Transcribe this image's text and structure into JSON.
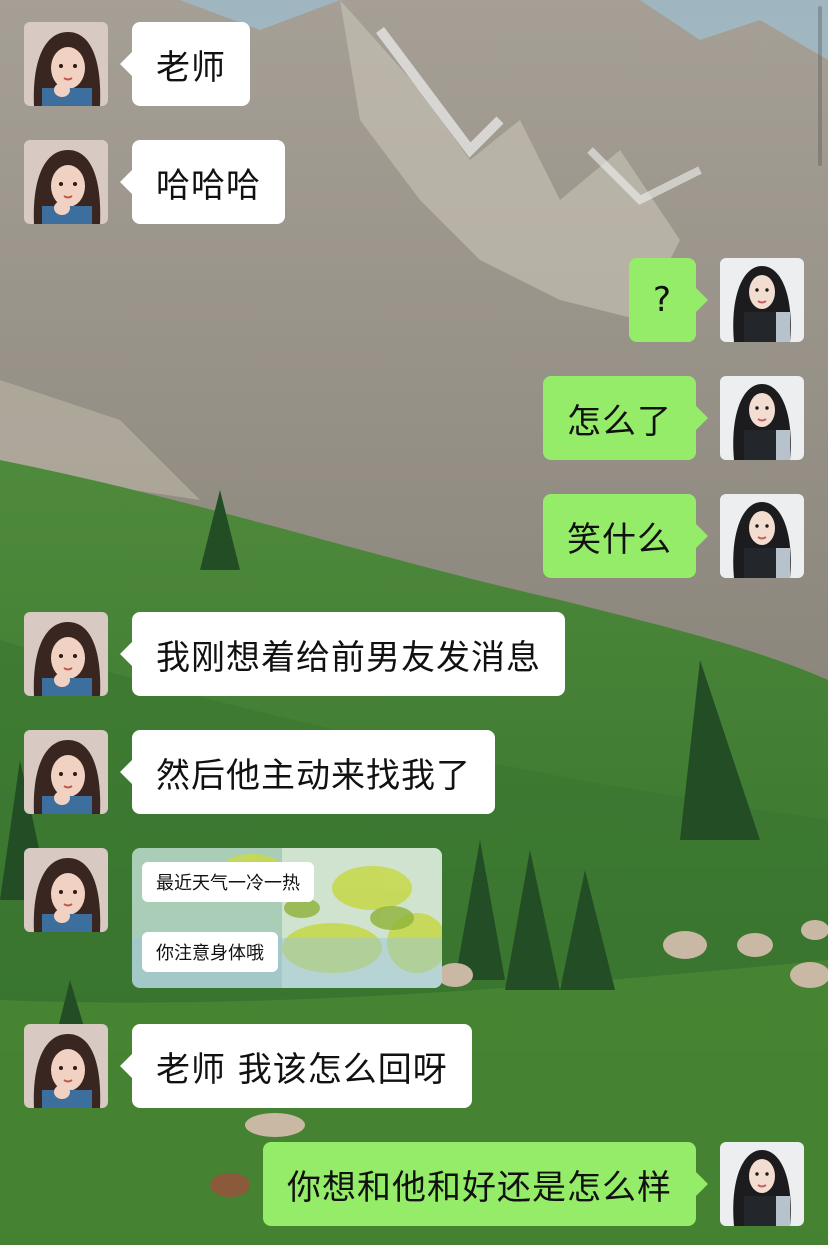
{
  "colors": {
    "incoming_bubble": "#ffffff",
    "outgoing_bubble": "#95ec69",
    "text": "#111111"
  },
  "messages": [
    {
      "side": "in",
      "text": "老师"
    },
    {
      "side": "in",
      "text": "哈哈哈"
    },
    {
      "side": "out",
      "text": "?"
    },
    {
      "side": "out",
      "text": "怎么了"
    },
    {
      "side": "out",
      "text": "笑什么"
    },
    {
      "side": "in",
      "text": "我刚想着给前男友发消息"
    },
    {
      "side": "in",
      "text": "然后他主动来找我了"
    },
    {
      "side": "in",
      "type": "image",
      "image_lines": [
        "最近天气一冷一热",
        "你注意身体哦"
      ]
    },
    {
      "side": "in",
      "text": "老师 我该怎么回呀"
    },
    {
      "side": "out",
      "text": "你想和他和好还是怎么样"
    }
  ],
  "icons": {
    "incoming_avatar": "girl-avatar-icon",
    "outgoing_avatar": "woman-avatar-icon"
  }
}
